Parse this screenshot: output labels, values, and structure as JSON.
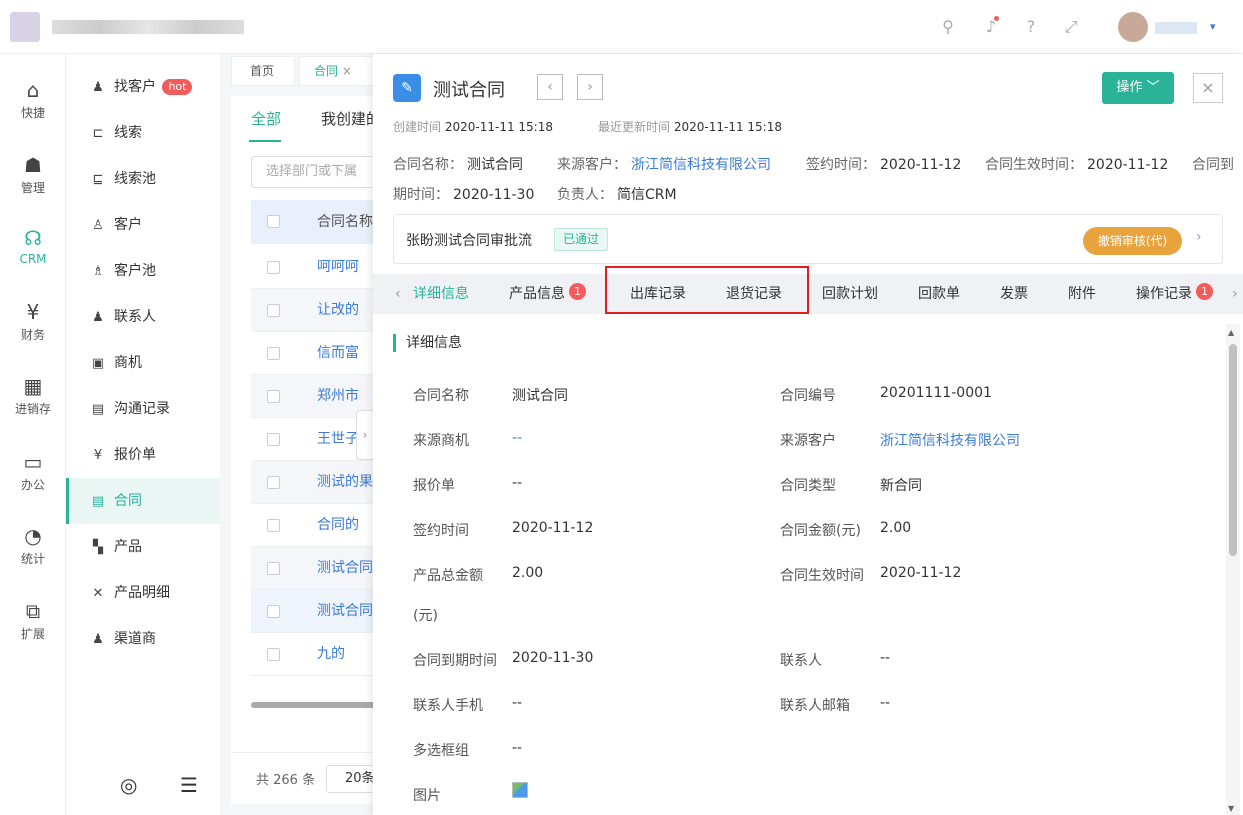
{
  "header": {
    "icons": [
      "search-icon",
      "bell-icon",
      "help-icon",
      "fullscreen-icon"
    ],
    "dropdown_glyph": "▾"
  },
  "rail": [
    {
      "label": "快捷",
      "icon": "⌂"
    },
    {
      "label": "管理",
      "icon": "☗"
    },
    {
      "label": "CRM",
      "icon": "☊"
    },
    {
      "label": "财务",
      "icon": "¥"
    },
    {
      "label": "进销存",
      "icon": "▦"
    },
    {
      "label": "办公",
      "icon": "▭"
    },
    {
      "label": "统计",
      "icon": "◔"
    },
    {
      "label": "扩展",
      "icon": "⧉"
    }
  ],
  "menu": {
    "items": [
      {
        "label": "找客户",
        "icon": "♟"
      },
      {
        "label": "线索",
        "icon": "⊏"
      },
      {
        "label": "线索池",
        "icon": "⊑"
      },
      {
        "label": "客户",
        "icon": "♙"
      },
      {
        "label": "客户池",
        "icon": "♗"
      },
      {
        "label": "联系人",
        "icon": "♟"
      },
      {
        "label": "商机",
        "icon": "▣"
      },
      {
        "label": "沟通记录",
        "icon": "▤"
      },
      {
        "label": "报价单",
        "icon": "¥"
      },
      {
        "label": "合同",
        "icon": "▤"
      },
      {
        "label": "产品",
        "icon": "▚"
      },
      {
        "label": "产品明细",
        "icon": "✕"
      },
      {
        "label": "渠道商",
        "icon": "♟"
      }
    ],
    "hot_label": "hot"
  },
  "tabs": [
    {
      "label": "首页"
    },
    {
      "label": "合同",
      "close": "×"
    }
  ],
  "list": {
    "tabs": [
      "全部",
      "我创建的"
    ],
    "filter_placeholder": "选择部门或下属",
    "column": "合同名称",
    "rows": [
      "呵呵呵",
      "让改的",
      "信而富",
      "郑州市",
      "王世子",
      "测试的果",
      "合同的",
      "测试合同",
      "测试合同",
      "九的"
    ],
    "total": "共 266 条",
    "page_size": "20条"
  },
  "detail": {
    "title": "测试合同",
    "nav_prev": "‹",
    "nav_next": "›",
    "op_label": "操作 ﹀",
    "close": "×",
    "created_label": "创建时间",
    "created": "2020-11-11 15:18",
    "updated_label": "最近更新时间",
    "updated": "2020-11-11 15:18",
    "summary": {
      "name_label": "合同名称：",
      "name": "测试合同",
      "cust_label": "来源客户：",
      "cust": "浙江简信科技有限公司",
      "sign_label": "签约时间：",
      "sign": "2020-11-12",
      "eff_label": "合同生效时间：",
      "eff": "2020-11-12",
      "exp_label_a": "合同到",
      "exp_label_b": "期时间：",
      "exp": "2020-11-30",
      "owner_label": "负责人：",
      "owner": "简信CRM"
    },
    "approval": {
      "title": "张盼测试合同审批流",
      "status": "已通过",
      "revoke": "撤销审核(代)",
      "arrow": "›"
    },
    "tabs": [
      {
        "label": "详细信息",
        "active": true
      },
      {
        "label": "产品信息",
        "badge": "1"
      },
      {
        "label": "出库记录"
      },
      {
        "label": "退货记录"
      },
      {
        "label": "回款计划"
      },
      {
        "label": "回款单"
      },
      {
        "label": "发票"
      },
      {
        "label": "附件"
      },
      {
        "label": "操作记录",
        "badge": "1"
      }
    ],
    "tabs_left": "‹",
    "tabs_right": "›",
    "section": "详细信息",
    "fields_left": [
      {
        "label": "合同名称",
        "value": "测试合同"
      },
      {
        "label": "来源商机",
        "value": "--",
        "link": true
      },
      {
        "label": "报价单",
        "value": "--"
      },
      {
        "label": "签约时间",
        "value": "2020-11-12"
      },
      {
        "label": "产品总金额",
        "value": "2.00",
        "label2": "(元)"
      },
      {
        "label": "合同到期时间",
        "value": "2020-11-30"
      },
      {
        "label": "联系人手机",
        "value": "--"
      },
      {
        "label": "多选框组",
        "value": "--"
      },
      {
        "label": "图片",
        "value": ""
      }
    ],
    "fields_right": [
      {
        "label": "合同编号",
        "value": "20201111-0001"
      },
      {
        "label": "来源客户",
        "value": "浙江简信科技有限公司",
        "link": true
      },
      {
        "label": "合同类型",
        "value": "新合同"
      },
      {
        "label": "合同金额(元)",
        "value": "2.00"
      },
      {
        "label": "合同生效时间",
        "value": "2020-11-12"
      },
      {
        "label": "联系人",
        "value": "--"
      },
      {
        "label": "联系人邮箱",
        "value": "--"
      }
    ]
  },
  "colors": {
    "accent": "#2bb39a",
    "link": "#3a7bd5",
    "hot": "#f45c5c",
    "revoke": "#e8a33d",
    "highlight": "#e02020"
  }
}
